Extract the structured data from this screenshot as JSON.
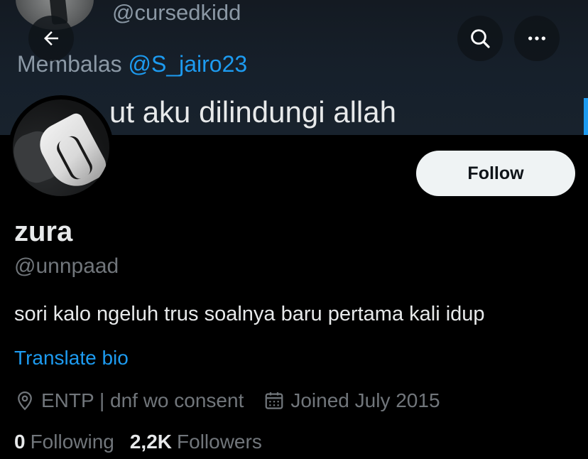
{
  "banner": {
    "handle": "@cursedkidd",
    "reply_prefix": "Membalas",
    "reply_mention": "@S_jairo23",
    "tweet_text": "ut aku dilindungi allah"
  },
  "top_bar": {
    "back_icon": "arrow-left-icon",
    "search_icon": "search-icon",
    "more_icon": "more-horizontal-icon"
  },
  "profile": {
    "follow_label": "Follow",
    "display_name": "zura",
    "handle": "@unnpaad",
    "bio": "sori kalo ngeluh trus soalnya baru pertama kali idup",
    "translate_label": "Translate bio",
    "location": "ENTP | dnf wo consent",
    "joined": "Joined July 2015",
    "following_count": "0",
    "following_label": "Following",
    "followers_count": "2,2K",
    "followers_label": "Followers"
  },
  "colors": {
    "background": "#000000",
    "text": "#e7e9ea",
    "secondary_text": "#71767b",
    "accent": "#1d9bf0",
    "follow_button_bg": "#eff3f4"
  }
}
